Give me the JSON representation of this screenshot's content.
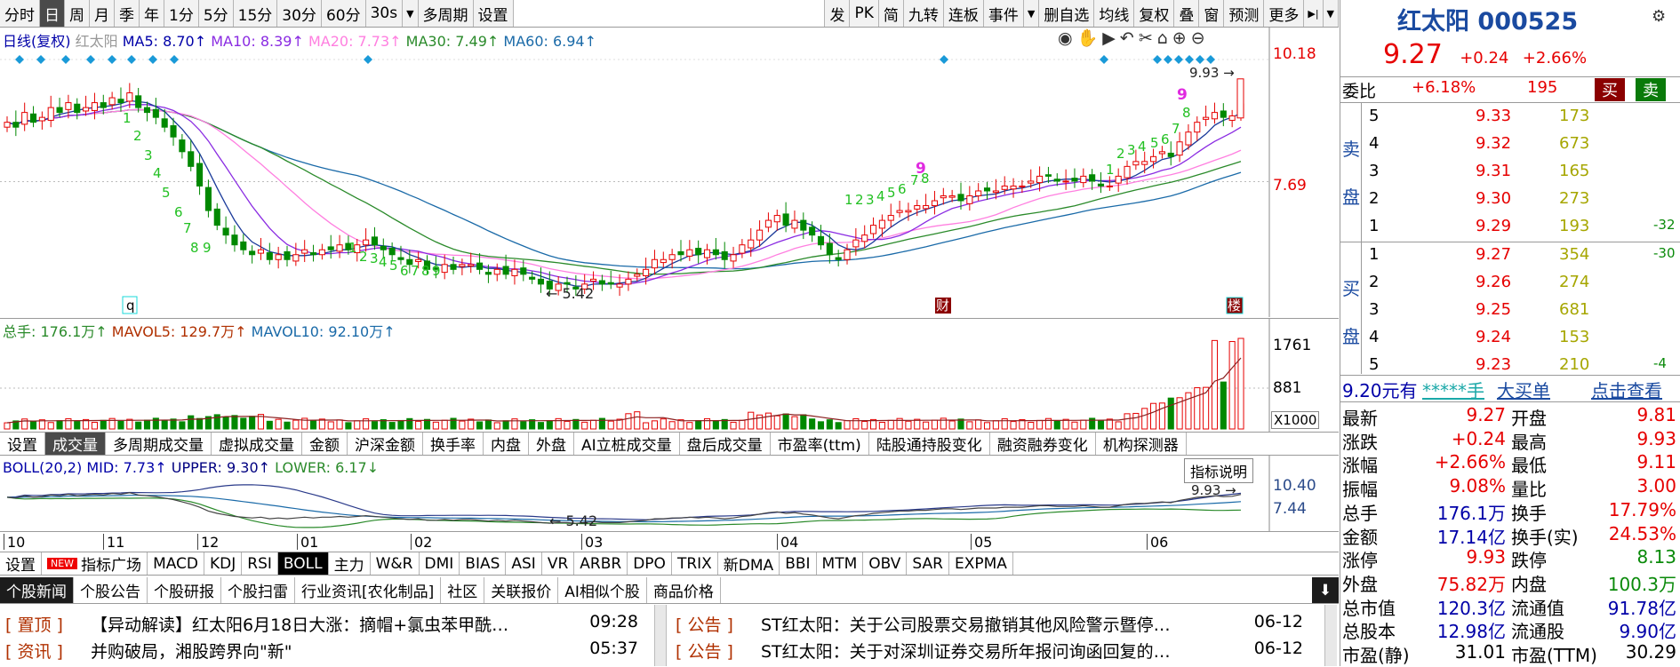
{
  "toolbar": {
    "left": [
      "分时",
      "日",
      "周",
      "月",
      "季",
      "年",
      "1分",
      "5分",
      "15分",
      "30分",
      "60分",
      "30s",
      "多周期",
      "设置"
    ],
    "active": 1,
    "right": [
      "发",
      "PK",
      "简",
      "九转",
      "连板",
      "事件",
      "删自选",
      "均线",
      "复权",
      "叠",
      "窗",
      "预测",
      "更多"
    ]
  },
  "price_legend": {
    "name": "日线(复权)",
    "stock": "红太阳",
    "ma5": "MA5: 8.70↑",
    "ma10": "MA10: 8.39↑",
    "ma20": "MA20: 7.73↑",
    "ma30": "MA30: 7.49↑",
    "ma60": "MA60: 6.94↑"
  },
  "price_axis": {
    "top": "10.18",
    "mid": "7.69"
  },
  "price_marks": {
    "high": "9.93",
    "low": "5.42",
    "q": "q",
    "cai": "财",
    "lou": "楼"
  },
  "vol_legend": {
    "total": "总手: 176.1万↑",
    "mavol5": "MAVOL5: 129.7万↑",
    "mavol10": "MAVOL10: 92.10万↑"
  },
  "vol_axis": {
    "top": "1761",
    "mid": "881",
    "unit": "X1000"
  },
  "indicator_tabs": [
    "设置",
    "成交量",
    "多周期成交量",
    "虚拟成交量",
    "金额",
    "沪深金额",
    "换手率",
    "内盘",
    "外盘",
    "AI立桩成交量",
    "盘后成交量",
    "市盈率(ttm)",
    "陆股通持股变化",
    "融资融券变化",
    "机构探测器"
  ],
  "indicator_active": 1,
  "boll_legend": {
    "name": "BOLL(20,2)",
    "mid": "MID: 7.73↑",
    "upper": "UPPER: 9.30↑",
    "lower": "LOWER: 6.17↓"
  },
  "boll_axis": {
    "top": "10.40",
    "mid": "7.44"
  },
  "boll_marks": {
    "high": "9.93",
    "low": "5.42",
    "help": "指标说明"
  },
  "months": [
    "10",
    "11",
    "12",
    "01",
    "02",
    "03",
    "04",
    "05",
    "06"
  ],
  "indicators": [
    "设置",
    "指标广场",
    "MACD",
    "KDJ",
    "RSI",
    "BOLL",
    "主力",
    "W&R",
    "DMI",
    "BIAS",
    "ASI",
    "VR",
    "ARBR",
    "DPO",
    "TRIX",
    "新DMA",
    "BBI",
    "MTM",
    "OBV",
    "SAR",
    "EXPMA"
  ],
  "indicators_new": "NEW",
  "indicators_active": 5,
  "news_tabs": [
    "个股新闻",
    "个股公告",
    "个股研报",
    "个股扫雷",
    "行业资讯[农化制品]",
    "社区",
    "关联报价",
    "AI相似个股",
    "商品价格"
  ],
  "news_left": [
    {
      "cat": "[ 置顶 ]",
      "title": "【异动解读】红太阳6月18日大涨：摘帽+氯虫苯甲酰…",
      "time": "09:28"
    },
    {
      "cat": "[ 资讯 ]",
      "title": "并购破局，湘股跨界向\"新\"",
      "time": "05:37"
    }
  ],
  "news_right": [
    {
      "cat": "[ 公告 ]",
      "title": "ST红太阳：关于公司股票交易撤销其他风险警示暨停…",
      "time": "06-12"
    },
    {
      "cat": "[ 公告 ]",
      "title": "ST红太阳：关于对深圳证券交易所年报问询函回复的…",
      "time": "06-12"
    }
  ],
  "quote": {
    "name": "红太阳",
    "code": "000525",
    "price": "9.27",
    "change": "+0.24",
    "pct": "+2.66%",
    "weibi_label": "委比",
    "weibi": "+6.18%",
    "weicha": "195",
    "buy_btn": "买",
    "sell_btn": "卖",
    "sell_label": [
      "卖",
      "盘"
    ],
    "buy_label": [
      "买",
      "盘"
    ],
    "asks": [
      {
        "n": "5",
        "p": "9.33",
        "v": "173",
        "d": ""
      },
      {
        "n": "4",
        "p": "9.32",
        "v": "673",
        "d": ""
      },
      {
        "n": "3",
        "p": "9.31",
        "v": "165",
        "d": ""
      },
      {
        "n": "2",
        "p": "9.30",
        "v": "273",
        "d": ""
      },
      {
        "n": "1",
        "p": "9.29",
        "v": "193",
        "d": "-32"
      }
    ],
    "bids": [
      {
        "n": "1",
        "p": "9.27",
        "v": "354",
        "d": "-30"
      },
      {
        "n": "2",
        "p": "9.26",
        "v": "274",
        "d": ""
      },
      {
        "n": "3",
        "p": "9.25",
        "v": "681",
        "d": ""
      },
      {
        "n": "4",
        "p": "9.24",
        "v": "153",
        "d": ""
      },
      {
        "n": "5",
        "p": "9.23",
        "v": "210",
        "d": "-4"
      }
    ],
    "bigorder": {
      "a": "9.20元有",
      "b": "*****手",
      "c": "大买单",
      "d": "点击查看"
    },
    "stats": [
      [
        "最新",
        "9.27",
        "开盘",
        "9.81"
      ],
      [
        "涨跌",
        "+0.24",
        "最高",
        "9.93"
      ],
      [
        "涨幅",
        "+2.66%",
        "最低",
        "9.11"
      ],
      [
        "振幅",
        "9.08%",
        "量比",
        "3.00"
      ],
      [
        "总手",
        "176.1万",
        "换手",
        "17.79%"
      ],
      [
        "金额",
        "17.14亿",
        "换手(实)",
        "24.53%"
      ],
      [
        "涨停",
        "9.93",
        "跌停",
        "8.13"
      ],
      [
        "外盘",
        "75.82万",
        "内盘",
        "100.3万"
      ],
      [
        "总市值",
        "120.3亿",
        "流通值",
        "91.78亿"
      ],
      [
        "总股本",
        "12.98亿",
        "流通股",
        "9.90亿"
      ],
      [
        "市盈(静)",
        "31.01",
        "市盈(TTM)",
        "30.29"
      ]
    ]
  },
  "chart_data": {
    "type": "candlestick",
    "x_ticks": [
      "10",
      "11",
      "12",
      "01",
      "02",
      "03",
      "04",
      "05",
      "06"
    ],
    "ylim": [
      5.0,
      10.18
    ],
    "y_ticks": [
      "10.18",
      "7.69"
    ],
    "closes": [
      8.9,
      8.8,
      9.1,
      8.9,
      9.0,
      9.2,
      9.1,
      9.3,
      9.1,
      9.2,
      9.3,
      9.2,
      9.4,
      9.3,
      9.5,
      9.2,
      9.1,
      9.0,
      8.8,
      8.6,
      8.3,
      8.0,
      7.6,
      7.1,
      6.8,
      6.6,
      6.4,
      6.3,
      6.2,
      6.3,
      6.1,
      6.2,
      6.1,
      6.2,
      6.3,
      6.2,
      6.3,
      6.3,
      6.4,
      6.3,
      6.4,
      6.5,
      6.4,
      6.3,
      6.2,
      6.1,
      6.0,
      6.1,
      5.9,
      5.9,
      6.0,
      5.9,
      6.0,
      6.0,
      5.9,
      5.8,
      5.9,
      5.8,
      5.9,
      5.8,
      5.7,
      5.6,
      5.5,
      5.6,
      5.6,
      5.5,
      5.6,
      5.7,
      5.6,
      5.6,
      5.6,
      5.7,
      5.8,
      5.9,
      6.1,
      6.1,
      6.2,
      6.2,
      6.3,
      6.2,
      6.3,
      6.2,
      6.1,
      6.2,
      6.4,
      6.5,
      6.7,
      6.9,
      7.0,
      6.8,
      6.9,
      6.7,
      6.6,
      6.4,
      6.2,
      6.1,
      6.3,
      6.5,
      6.6,
      6.8,
      6.9,
      7.0,
      7.1,
      7.1,
      7.2,
      7.2,
      7.3,
      7.4,
      7.4,
      7.3,
      7.4,
      7.5,
      7.5,
      7.5,
      7.6,
      7.6,
      7.6,
      7.7,
      7.8,
      7.8,
      7.7,
      7.7,
      7.7,
      7.8,
      7.7,
      7.6,
      7.6,
      7.8,
      8.0,
      8.1,
      8.1,
      8.2,
      8.3,
      8.2,
      8.5,
      8.7,
      8.9,
      9.0,
      9.1,
      9.0,
      9.03,
      9.27
    ],
    "volume_ticks": [
      "1761",
      "881"
    ],
    "volume_unit": "X1000"
  }
}
